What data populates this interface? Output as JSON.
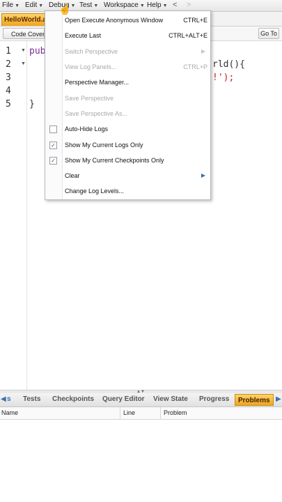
{
  "menubar": {
    "items": [
      {
        "label": "File"
      },
      {
        "label": "Edit"
      },
      {
        "label": "Debug"
      },
      {
        "label": "Test"
      },
      {
        "label": "Workspace"
      },
      {
        "label": "Help"
      }
    ],
    "back": "<",
    "forward": ">"
  },
  "file_tab": {
    "label": "HelloWorld.apxc"
  },
  "toolbar": {
    "coverage_label": "Code Coverage",
    "goto_label": "Go To"
  },
  "editor": {
    "lines": [
      {
        "num": "1",
        "left": "publ",
        "right": "rld(){"
      },
      {
        "num": "2",
        "left": "",
        "right": "!');"
      },
      {
        "num": "3",
        "left": "",
        "right": ""
      },
      {
        "num": "4",
        "left": "",
        "right": ""
      },
      {
        "num": "5",
        "left": "}",
        "right": ""
      }
    ]
  },
  "debug_menu": {
    "items": [
      {
        "label": "Open Execute Anonymous Window",
        "shortcut": "CTRL+E",
        "enabled": true
      },
      {
        "label": "Execute Last",
        "shortcut": "CTRL+ALT+E",
        "enabled": true
      },
      {
        "label": "Switch Perspective",
        "enabled": false,
        "submenu": true
      },
      {
        "label": "View Log Panels...",
        "shortcut": "CTRL+P",
        "enabled": false
      },
      {
        "label": "Perspective Manager...",
        "enabled": true
      },
      {
        "label": "Save Perspective",
        "enabled": false
      },
      {
        "label": "Save Perspective As...",
        "enabled": false
      },
      {
        "label": "Auto-Hide Logs",
        "enabled": true,
        "checked": false
      },
      {
        "label": "Show My Current Logs Only",
        "enabled": true,
        "checked": true
      },
      {
        "label": "Show My Current Checkpoints Only",
        "enabled": true,
        "checked": true
      },
      {
        "label": "Clear",
        "enabled": true,
        "submenu": true
      },
      {
        "label": "Change Log Levels...",
        "enabled": true
      }
    ]
  },
  "panel_tabs": {
    "partial_tab": "s",
    "tabs": [
      {
        "label": "Tests"
      },
      {
        "label": "Checkpoints"
      },
      {
        "label": "Query Editor"
      },
      {
        "label": "View State"
      },
      {
        "label": "Progress"
      },
      {
        "label": "Problems",
        "active": true
      }
    ]
  },
  "problems_table": {
    "columns": [
      {
        "label": "Name"
      },
      {
        "label": "Line"
      },
      {
        "label": "Problem"
      }
    ]
  },
  "colors": {
    "accent": "#f2a41e",
    "keyword": "#7a2a9a",
    "string": "#c02020"
  }
}
